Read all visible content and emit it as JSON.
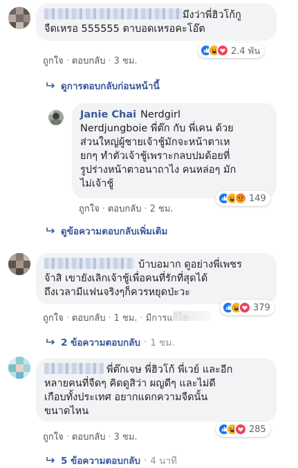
{
  "comments": [
    {
      "text": "มึงว่าพี่ฮิวโก้กู จืดเหรอ 555555 ตาบอดเหรอคะโอ๊ต",
      "line1": "มึงว่าพี่ฮิวโก้กู",
      "line2": "จืดเหรอ 555555 ตาบอดเหรอคะโอ๊ต",
      "like": "ถูกใจ",
      "reply": "ตอบกลับ",
      "time": "3 ชม.",
      "reaction_count": "2.4 พัน",
      "reactions": [
        "like",
        "haha",
        "love"
      ]
    },
    {
      "author": "Janie Chai",
      "tag": "Nerdgirl",
      "lines": [
        "Nerdjungboie พี่ต๊ก กับ พี่เคน ด้วย",
        "ส่วนใหญ่ผู้ชายเจ้าชู้มักจะหน้าตาเห",
        "ยกๆ ทำตัวเจ้าชู้เพราะกลบปมด้อยที่",
        "รูปร่างหน้าตาอนาถาไง คนหล่อๆ มัก",
        "ไม่เจ้าชู้"
      ],
      "like": "ถูกใจ",
      "reply": "ตอบกลับ",
      "time": "2 ชม.",
      "reaction_count": "149",
      "reactions": [
        "like",
        "haha",
        "angry"
      ]
    },
    {
      "lines": [
        "บ้าบอมาก ดูอย่างพี่เพชร",
        "จ้าสิ เขายังเลิกเจ้าชู้เพื่อคนที่รักที่สุดได้",
        "ถึงเวลามีแฟนจริงๆก็ควรหยุดป่ะวะ"
      ],
      "like": "ถูกใจ",
      "reply": "ตอบกลับ",
      "time": "1 ชม.",
      "edited": "มีการแก้ไข",
      "reaction_count": "379",
      "reactions": [
        "like",
        "haha",
        "love"
      ]
    },
    {
      "lines": [
        "พี่ต๊กเจษ พี่ฮิวโก้ พี่เวย์ และอีก",
        "หลายคนที่จืดๆ คิดดูสิว่า ผญดีๆ และไม่ดี",
        "เกือบทั้งประเทศ อยากแดกความจืดนั้น",
        "ขนาดไหน"
      ],
      "like": "ถูกใจ",
      "reply": "ตอบกลับ",
      "time": "3 ชม.",
      "reaction_count": "285",
      "reactions": [
        "like",
        "haha",
        "love"
      ]
    }
  ],
  "reply_links": {
    "previous": "ดูการตอบกลับก่อนหน้านี้",
    "more": "ดูข้อความตอบกลับเพิ่มเติม",
    "thread3": "2 ข้อความตอบกลับ",
    "thread3_time": "1 ชม.",
    "thread4": "5 ข้อความตอบกลับ",
    "thread4_time": "4 นาที"
  },
  "colors": {
    "link": "#385898",
    "bubble": "#f2f3f5",
    "like": "#1877f2",
    "haha": "#f7b125",
    "love": "#f33e58",
    "angry": "#e9710f"
  }
}
